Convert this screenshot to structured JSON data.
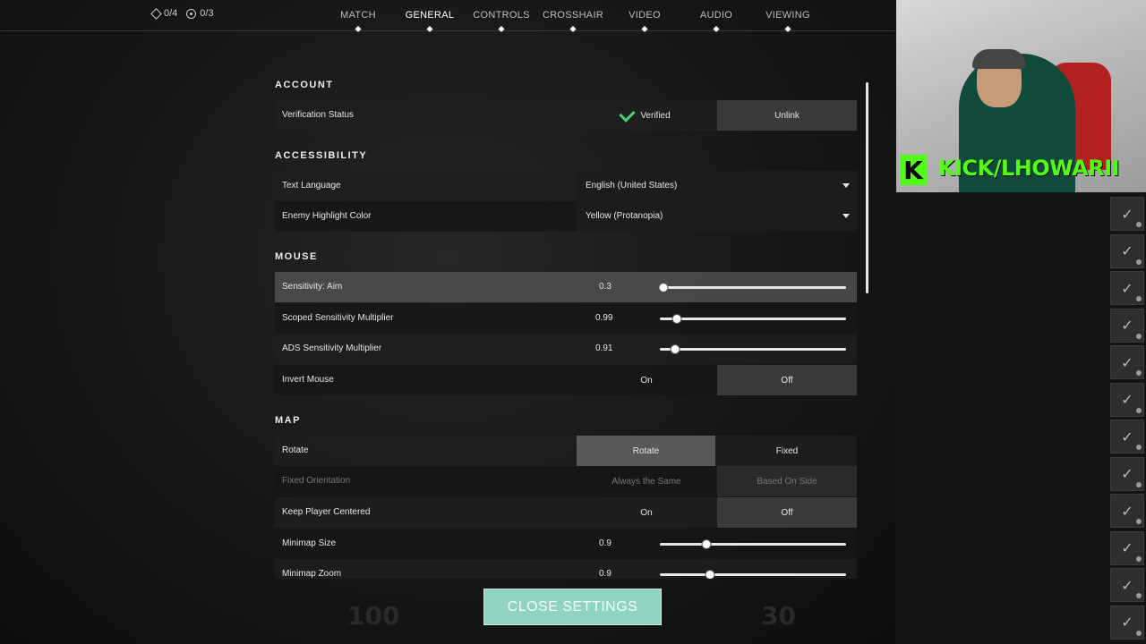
{
  "topbar": {
    "counter_a": "0/4",
    "counter_b": "0/3",
    "tabs": [
      {
        "label": "MATCH",
        "active": false
      },
      {
        "label": "GENERAL",
        "active": true
      },
      {
        "label": "CONTROLS",
        "active": false
      },
      {
        "label": "CROSSHAIR",
        "active": false
      },
      {
        "label": "VIDEO",
        "active": false
      },
      {
        "label": "AUDIO",
        "active": false
      },
      {
        "label": "VIEWING",
        "active": false
      }
    ]
  },
  "account": {
    "title": "ACCOUNT",
    "verification_label": "Verification Status",
    "verified_label": "Verified",
    "unlink_label": "Unlink"
  },
  "accessibility": {
    "title": "ACCESSIBILITY",
    "text_language_label": "Text Language",
    "text_language_value": "English (United States)",
    "enemy_color_label": "Enemy Highlight Color",
    "enemy_color_value": "Yellow (Protanopia)"
  },
  "mouse": {
    "title": "MOUSE",
    "sensitivity_label": "Sensitivity: Aim",
    "sensitivity_value": "0.3",
    "sensitivity_fraction": 0.02,
    "scoped_label": "Scoped Sensitivity Multiplier",
    "scoped_value": "0.99",
    "scoped_fraction": 0.09,
    "ads_label": "ADS Sensitivity Multiplier",
    "ads_value": "0.91",
    "ads_fraction": 0.08,
    "invert_label": "Invert Mouse",
    "invert_on": "On",
    "invert_off": "Off",
    "invert_selected": "Off"
  },
  "map": {
    "title": "MAP",
    "rotate_label": "Rotate",
    "rotate_opt": "Rotate",
    "fixed_opt": "Fixed",
    "rotate_selected": "Rotate",
    "fixed_orientation_label": "Fixed Orientation",
    "always_same": "Always the Same",
    "based_on_side": "Based On Side",
    "keep_centered_label": "Keep Player Centered",
    "keep_on": "On",
    "keep_off": "Off",
    "keep_selected": "Off",
    "minimap_size_label": "Minimap Size",
    "minimap_size_value": "0.9",
    "minimap_size_fraction": 0.25,
    "minimap_zoom_label": "Minimap Zoom",
    "minimap_zoom_value": "0.9",
    "minimap_zoom_fraction": 0.27
  },
  "close_button": "CLOSE SETTINGS",
  "stream": {
    "kick_letter": "K",
    "kick_text": "KICK/LHOWARII"
  },
  "colors": {
    "accent": "#8fd3c0",
    "verified": "#4cd27a",
    "kick": "#53fc18"
  }
}
